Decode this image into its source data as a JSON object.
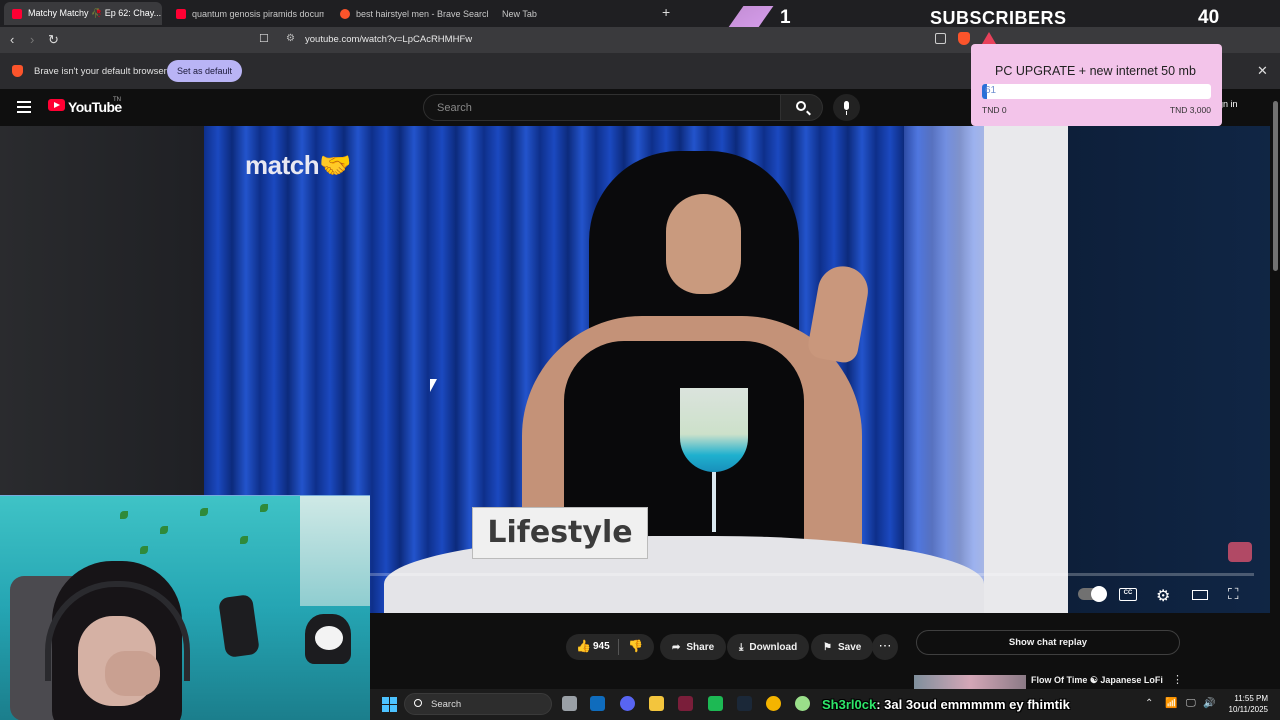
{
  "browser": {
    "tabs": [
      {
        "title": "Matchy Matchy 🥀 Ep 62: Chay..."
      },
      {
        "title": "quantum genosis piramids documen"
      },
      {
        "title": "best hairstyel men - Brave Search"
      },
      {
        "title": "New Tab"
      }
    ],
    "new_tab_symbol": "+",
    "close_symbol": "✕",
    "url": "youtube.com/watch?v=LpCAcRHMHFw",
    "infobar": {
      "message": "Brave isn't your default browser",
      "button": "Set as default",
      "close": "✕"
    }
  },
  "stream_overlay": {
    "subscriber_count": "1",
    "subscriber_label": "SUBSCRIBERS",
    "subscriber_goal": "40",
    "goal": {
      "title": "PC UPGRATE + new internet 50 mb",
      "current": "61",
      "min_label": "TND 0",
      "max_label": "TND 3,000",
      "progress_fraction": 0.02
    }
  },
  "youtube": {
    "logo_text": "YouTube",
    "logo_sup": "TN",
    "search_placeholder": "Search",
    "signin": "Sign in",
    "video": {
      "channel_logo_text": "match🤝",
      "table_card": "Lifestyle"
    },
    "actions": {
      "likes": "945",
      "share": "Share",
      "download": "Download",
      "save": "Save",
      "more": "⋯"
    },
    "chat_replay_button": "Show chat replay",
    "recommended": {
      "title": "Flow Of Time ☯ Japanese LoFi",
      "menu": "⋮"
    }
  },
  "taskbar": {
    "search_label": "Search",
    "chat_user": "Sh3rl0ck",
    "chat_message": ": 3al 3oud emmmmm ey fhimtik",
    "time": "11:55 PM",
    "date": "10/11/2025"
  },
  "colors": {
    "accent_brave": "#fb542b",
    "yt_red": "#ff0033",
    "goal_card": "#f3c4ea",
    "setdefault_button": "#b9b4f5",
    "chat_user": "#2ee66a"
  }
}
